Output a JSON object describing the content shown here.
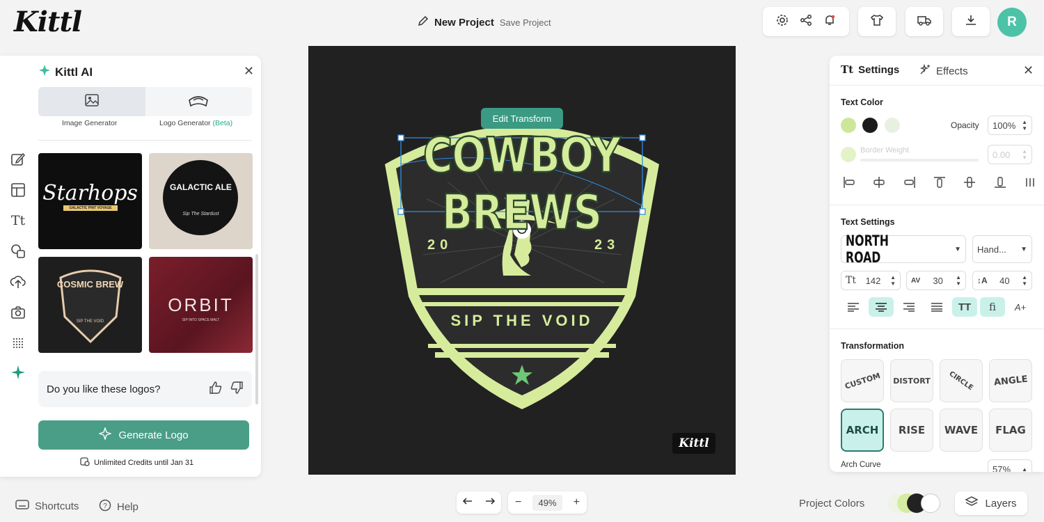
{
  "app": {
    "logo": "Kittl"
  },
  "header": {
    "project_name": "New Project",
    "save_label": "Save Project",
    "avatar_letter": "R"
  },
  "left_panel": {
    "title": "Kittl AI",
    "tabs": [
      {
        "label": "Image Generator"
      },
      {
        "label": "Logo Generator",
        "badge": "(Beta)"
      }
    ],
    "thumbnails": [
      {
        "text": "Starhops",
        "sub": "GALACTIC PINT VOYAGE"
      },
      {
        "text": "GALACTIC ALE",
        "sub": "Sip The Stardust"
      },
      {
        "text": "COSMIC BREW",
        "sub": "SIP THE VOID"
      },
      {
        "text": "ORBIT",
        "sub": "SIP INTO SPACE MALT"
      }
    ],
    "feedback_question": "Do you like these logos?",
    "generate_label": "Generate Logo",
    "credits": "Unlimited Credits until Jan 31"
  },
  "canvas": {
    "edit_transform_label": "Edit Transform",
    "headline": "COWBOY BREWS",
    "year_left": "20",
    "year_right": "23",
    "tagline": "SIP THE VOID",
    "watermark": "Kittl",
    "badge_color": "#d6ec9c",
    "bg_color": "#212121"
  },
  "right_panel": {
    "tabs": {
      "settings": "Settings",
      "effects": "Effects"
    },
    "text_color": {
      "heading": "Text Color",
      "opacity_label": "Opacity",
      "opacity_value": "100%",
      "swatches": [
        "#cde79a",
        "#1b1b1b",
        "#e8f0e2"
      ],
      "border_weight_label": "Border Weight",
      "border_weight_value": "0.00"
    },
    "text_settings": {
      "heading": "Text Settings",
      "font": "NORTH ROAD",
      "font_style": "Hand...",
      "size": "142",
      "letter_spacing": "30",
      "line_height": "40"
    },
    "transformation": {
      "heading": "Transformation",
      "options": [
        "CUSTOM",
        "DISTORT",
        "CIRCLE",
        "ANGLE",
        "ARCH",
        "RISE",
        "WAVE",
        "FLAG"
      ],
      "selected": "ARCH",
      "arch_curve_label": "Arch Curve",
      "arch_curve_value": "57%"
    }
  },
  "bottom": {
    "shortcuts": "Shortcuts",
    "help": "Help",
    "zoom": "49%",
    "project_colors": "Project Colors",
    "layers": "Layers"
  }
}
